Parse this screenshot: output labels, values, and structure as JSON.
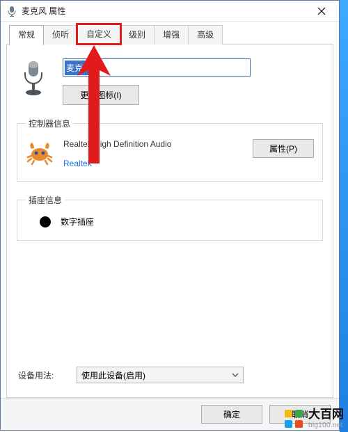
{
  "window": {
    "title": "麦克风 属性",
    "close_icon": "close"
  },
  "tabs": [
    "常规",
    "侦听",
    "自定义",
    "级别",
    "增强",
    "高级"
  ],
  "active_tab_index": 0,
  "highlighted_tab_index": 2,
  "general": {
    "device_name": "麦克风",
    "change_icon_btn": "更改图标(I)"
  },
  "controller": {
    "groupbox_title": "控制器信息",
    "name": "Realtek High Definition Audio",
    "vendor": "Realtek",
    "properties_btn": "属性(P)"
  },
  "jack": {
    "groupbox_title": "插座信息",
    "label": "数字插座",
    "dot_color": "#000000"
  },
  "usage": {
    "label": "设备用法:",
    "selected": "使用此设备(启用)"
  },
  "footer": {
    "ok": "确定",
    "cancel": "取消"
  },
  "watermark": {
    "brand": "大百网",
    "url": "big100.net"
  },
  "annotation": {
    "arrow_color": "#e11b1b"
  }
}
